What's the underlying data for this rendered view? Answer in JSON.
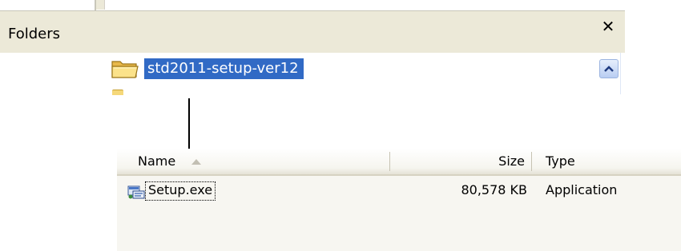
{
  "folders_pane": {
    "title": "Folders",
    "close_glyph": "✕",
    "selected_folder": "std2011-setup-ver12",
    "icons": [
      "folder-icon",
      "close-icon",
      "scroll-up-arrow-icon"
    ]
  },
  "file_list": {
    "columns": {
      "name": "Name",
      "size": "Size",
      "type": "Type"
    },
    "sort_column": "Name",
    "rows": [
      {
        "name": "Setup.exe",
        "size": "80,578 KB",
        "type": "Application",
        "icon": "setup-exe-icon"
      }
    ]
  },
  "colors": {
    "selection": "#316ac5",
    "header_bg": "#ece9d8",
    "list_bg": "#f7f6f1"
  }
}
